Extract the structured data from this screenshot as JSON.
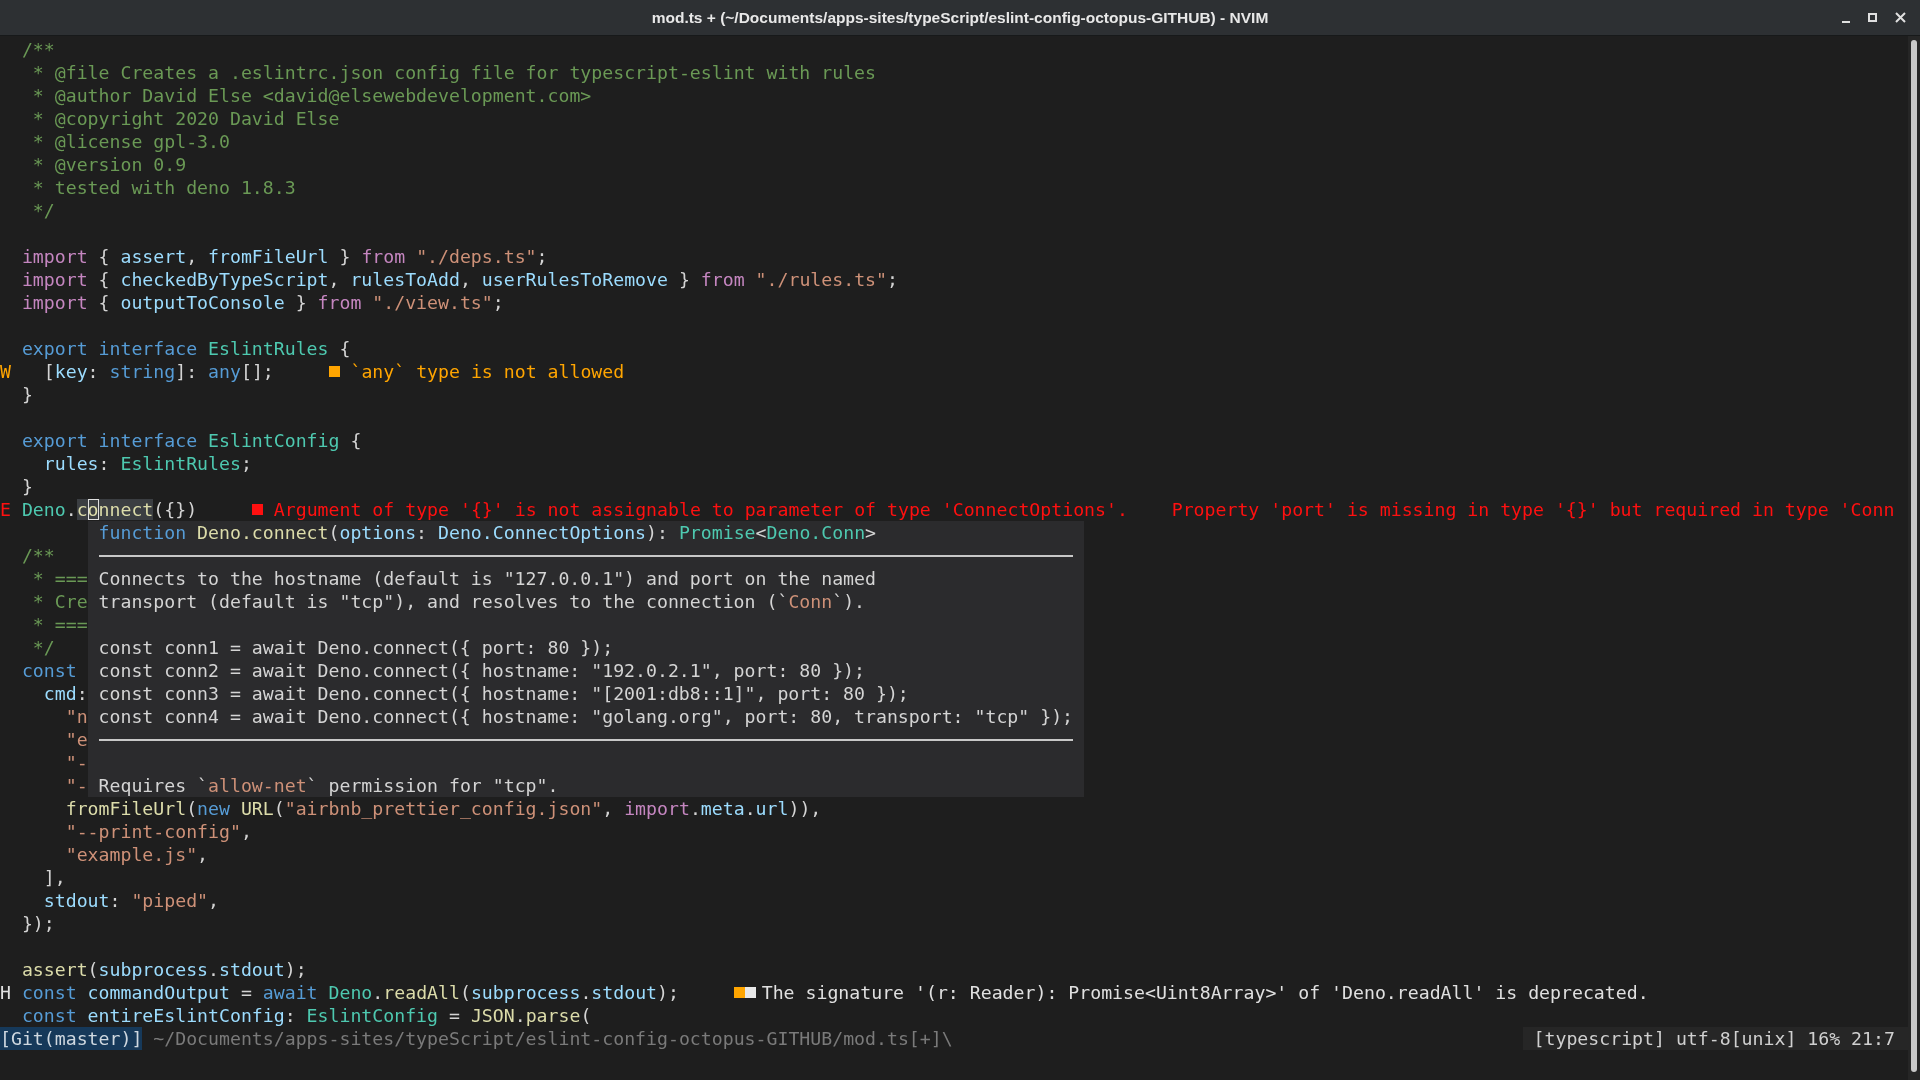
{
  "window": {
    "title": "mod.ts + (~/Documents/apps-sites/typeScript/eslint-config-octopus-GITHUB) - NVIM"
  },
  "lines": [
    {
      "kind": "code",
      "tokens": [
        {
          "kind": "comment",
          "text": "/**"
        }
      ]
    },
    {
      "kind": "code",
      "tokens": [
        {
          "kind": "comment",
          "text": " * @file Creates a .eslintrc.json config file for typescript-eslint with rules"
        }
      ]
    },
    {
      "kind": "code",
      "tokens": [
        {
          "kind": "comment",
          "text": " * @author David Else <david@elsewebdevelopment.com>"
        }
      ]
    },
    {
      "kind": "code",
      "tokens": [
        {
          "kind": "comment",
          "text": " * @copyright 2020 David Else"
        }
      ]
    },
    {
      "kind": "code",
      "tokens": [
        {
          "kind": "comment",
          "text": " * @license gpl-3.0"
        }
      ]
    },
    {
      "kind": "code",
      "tokens": [
        {
          "kind": "comment",
          "text": " * @version 0.9"
        }
      ]
    },
    {
      "kind": "code",
      "tokens": [
        {
          "kind": "comment",
          "text": " * tested with deno 1.8.3"
        }
      ]
    },
    {
      "kind": "code",
      "tokens": [
        {
          "kind": "comment",
          "text": " */"
        }
      ]
    },
    {
      "kind": "blank"
    },
    {
      "kind": "code",
      "tokens": [
        {
          "kind": "keyword",
          "text": "import"
        },
        {
          "kind": "plain",
          "text": " { "
        },
        {
          "kind": "variable",
          "text": "assert"
        },
        {
          "kind": "plain",
          "text": ", "
        },
        {
          "kind": "variable",
          "text": "fromFileUrl"
        },
        {
          "kind": "plain",
          "text": " } "
        },
        {
          "kind": "keyword",
          "text": "from "
        },
        {
          "kind": "string",
          "text": "\"./deps.ts\""
        },
        {
          "kind": "plain",
          "text": ";"
        }
      ]
    },
    {
      "kind": "code",
      "tokens": [
        {
          "kind": "keyword",
          "text": "import"
        },
        {
          "kind": "plain",
          "text": " { "
        },
        {
          "kind": "variable",
          "text": "checkedByTypeScript"
        },
        {
          "kind": "plain",
          "text": ", "
        },
        {
          "kind": "variable",
          "text": "rulesToAdd"
        },
        {
          "kind": "plain",
          "text": ", "
        },
        {
          "kind": "variable",
          "text": "userRulesToRemove"
        },
        {
          "kind": "plain",
          "text": " } "
        },
        {
          "kind": "keyword",
          "text": "from "
        },
        {
          "kind": "string",
          "text": "\"./rules.ts\""
        },
        {
          "kind": "plain",
          "text": ";"
        }
      ]
    },
    {
      "kind": "code",
      "tokens": [
        {
          "kind": "keyword",
          "text": "import"
        },
        {
          "kind": "plain",
          "text": " { "
        },
        {
          "kind": "variable",
          "text": "outputToConsole"
        },
        {
          "kind": "plain",
          "text": " } "
        },
        {
          "kind": "keyword",
          "text": "from "
        },
        {
          "kind": "string",
          "text": "\"./view.ts\""
        },
        {
          "kind": "plain",
          "text": ";"
        }
      ]
    },
    {
      "kind": "blank"
    },
    {
      "kind": "code",
      "tokens": [
        {
          "kind": "storage",
          "text": "export interface "
        },
        {
          "kind": "type",
          "text": "EslintRules"
        },
        {
          "kind": "plain",
          "text": " {"
        }
      ]
    },
    {
      "kind": "code",
      "sign": {
        "kind": "warning",
        "text": "W"
      },
      "tokens": [
        {
          "kind": "plain",
          "text": "  ["
        },
        {
          "kind": "variable",
          "text": "key"
        },
        {
          "kind": "plain",
          "text": ": "
        },
        {
          "kind": "storage",
          "text": "string"
        },
        {
          "kind": "plain",
          "text": "]: "
        },
        {
          "kind": "storage",
          "text": "any"
        },
        {
          "kind": "plain",
          "text": "[];"
        }
      ],
      "diagnostic": {
        "kind": "warning",
        "text": "`any` type is not allowed"
      }
    },
    {
      "kind": "code",
      "tokens": [
        {
          "kind": "plain",
          "text": "}"
        }
      ]
    },
    {
      "kind": "blank"
    },
    {
      "kind": "code",
      "tokens": [
        {
          "kind": "storage",
          "text": "export interface "
        },
        {
          "kind": "type",
          "text": "EslintConfig"
        },
        {
          "kind": "plain",
          "text": " {"
        }
      ]
    },
    {
      "kind": "code",
      "tokens": [
        {
          "kind": "variable",
          "text": "  rules"
        },
        {
          "kind": "plain",
          "text": ": "
        },
        {
          "kind": "type",
          "text": "EslintRules"
        },
        {
          "kind": "plain",
          "text": ";"
        }
      ]
    },
    {
      "kind": "code",
      "tokens": [
        {
          "kind": "plain",
          "text": "}"
        }
      ]
    },
    {
      "kind": "code",
      "sign": {
        "kind": "error",
        "text": "E"
      },
      "tokens": [
        {
          "kind": "type",
          "text": "Deno"
        },
        {
          "kind": "plain",
          "text": "."
        },
        {
          "kind": "function",
          "text": "c",
          "highlight": true
        },
        {
          "kind": "function",
          "text": "o",
          "highlight": true,
          "cursor": true
        },
        {
          "kind": "function",
          "text": "nnect",
          "highlight": true
        },
        {
          "kind": "plain",
          "text": "({})"
        }
      ],
      "diagnostic": {
        "kind": "error",
        "text": "Argument of type '{}' is not assignable to parameter of type 'ConnectOptions'.    Property 'port' is missing in type '{}' but required in type 'Conn"
      }
    },
    {
      "kind": "blank"
    },
    {
      "kind": "code",
      "tokens": [
        {
          "kind": "comment",
          "text": "/**"
        }
      ]
    },
    {
      "kind": "code",
      "tokens": [
        {
          "kind": "comment",
          "text": " * ==="
        }
      ]
    },
    {
      "kind": "code",
      "tokens": [
        {
          "kind": "comment",
          "text": " * Cre"
        }
      ]
    },
    {
      "kind": "code",
      "tokens": [
        {
          "kind": "comment",
          "text": " * ==="
        }
      ]
    },
    {
      "kind": "code",
      "tokens": [
        {
          "kind": "comment",
          "text": " */"
        }
      ]
    },
    {
      "kind": "code",
      "tokens": [
        {
          "kind": "storage",
          "text": "const"
        }
      ]
    },
    {
      "kind": "code",
      "tokens": [
        {
          "kind": "variable",
          "text": "  cmd"
        },
        {
          "kind": "plain",
          "text": ":"
        }
      ]
    },
    {
      "kind": "code",
      "tokens": [
        {
          "kind": "string",
          "text": "    \"n"
        }
      ]
    },
    {
      "kind": "code",
      "tokens": [
        {
          "kind": "string",
          "text": "    \"e"
        }
      ]
    },
    {
      "kind": "code",
      "tokens": [
        {
          "kind": "string",
          "text": "    \"-"
        }
      ]
    },
    {
      "kind": "code",
      "tokens": [
        {
          "kind": "string",
          "text": "    \"-"
        }
      ]
    },
    {
      "kind": "code",
      "tokens": [
        {
          "kind": "function",
          "text": "    fromFileUrl"
        },
        {
          "kind": "plain",
          "text": "("
        },
        {
          "kind": "storage",
          "text": "new "
        },
        {
          "kind": "function",
          "text": "URL"
        },
        {
          "kind": "plain",
          "text": "("
        },
        {
          "kind": "string",
          "text": "\"airbnb_prettier_config.json\""
        },
        {
          "kind": "plain",
          "text": ", "
        },
        {
          "kind": "keyword",
          "text": "import"
        },
        {
          "kind": "plain",
          "text": "."
        },
        {
          "kind": "variable",
          "text": "meta"
        },
        {
          "kind": "plain",
          "text": "."
        },
        {
          "kind": "variable",
          "text": "url"
        },
        {
          "kind": "plain",
          "text": ")),"
        }
      ]
    },
    {
      "kind": "code",
      "tokens": [
        {
          "kind": "string",
          "text": "    \"--print-config\""
        },
        {
          "kind": "plain",
          "text": ","
        }
      ]
    },
    {
      "kind": "code",
      "tokens": [
        {
          "kind": "string",
          "text": "    \"example.js\""
        },
        {
          "kind": "plain",
          "text": ","
        }
      ]
    },
    {
      "kind": "code",
      "tokens": [
        {
          "kind": "plain",
          "text": "  ],"
        }
      ]
    },
    {
      "kind": "code",
      "tokens": [
        {
          "kind": "variable",
          "text": "  stdout"
        },
        {
          "kind": "plain",
          "text": ": "
        },
        {
          "kind": "string",
          "text": "\"piped\""
        },
        {
          "kind": "plain",
          "text": ","
        }
      ]
    },
    {
      "kind": "code",
      "tokens": [
        {
          "kind": "plain",
          "text": "});"
        }
      ]
    },
    {
      "kind": "blank"
    },
    {
      "kind": "code",
      "tokens": [
        {
          "kind": "function",
          "text": "assert"
        },
        {
          "kind": "plain",
          "text": "("
        },
        {
          "kind": "variable",
          "text": "subprocess"
        },
        {
          "kind": "plain",
          "text": "."
        },
        {
          "kind": "variable",
          "text": "stdout"
        },
        {
          "kind": "plain",
          "text": ");"
        }
      ]
    },
    {
      "kind": "code",
      "sign": {
        "kind": "hint",
        "text": "H"
      },
      "tokens": [
        {
          "kind": "storage",
          "text": "const "
        },
        {
          "kind": "variable",
          "text": "commandOutput"
        },
        {
          "kind": "plain",
          "text": " = "
        },
        {
          "kind": "storage",
          "text": "await "
        },
        {
          "kind": "type",
          "text": "Deno"
        },
        {
          "kind": "plain",
          "text": "."
        },
        {
          "kind": "function",
          "text": "readAll"
        },
        {
          "kind": "plain",
          "text": "("
        },
        {
          "kind": "variable",
          "text": "subprocess"
        },
        {
          "kind": "plain",
          "text": "."
        },
        {
          "kind": "variable",
          "text": "stdout"
        },
        {
          "kind": "plain",
          "text": ");"
        }
      ],
      "diagnostic": {
        "kind": "hint",
        "text": "The signature '(r: Reader): Promise<Uint8Array>' of 'Deno.readAll' is deprecated."
      }
    },
    {
      "kind": "code",
      "tokens": [
        {
          "kind": "storage",
          "text": "const "
        },
        {
          "kind": "variable",
          "text": "entireEslintConfig"
        },
        {
          "kind": "plain",
          "text": ": "
        },
        {
          "kind": "type",
          "text": "EslintConfig"
        },
        {
          "kind": "plain",
          "text": " = "
        },
        {
          "kind": "function",
          "text": "JSON"
        },
        {
          "kind": "plain",
          "text": "."
        },
        {
          "kind": "function",
          "text": "parse"
        },
        {
          "kind": "plain",
          "text": "("
        }
      ]
    }
  ],
  "hover_popup": {
    "signature": [
      {
        "kind": "storage",
        "text": "function "
      },
      {
        "kind": "function",
        "text": "Deno.connect"
      },
      {
        "kind": "plain",
        "text": "("
      },
      {
        "kind": "variable",
        "text": "options"
      },
      {
        "kind": "plain",
        "text": ": "
      },
      {
        "kind": "variable",
        "text": "Deno.ConnectOptions"
      },
      {
        "kind": "plain",
        "text": "): "
      },
      {
        "kind": "type",
        "text": "Promise"
      },
      {
        "kind": "plain",
        "text": "<"
      },
      {
        "kind": "type",
        "text": "Deno.Conn"
      },
      {
        "kind": "plain",
        "text": ">"
      }
    ],
    "description": [
      [
        {
          "kind": "plain",
          "text": "Connects to the hostname (default is \"127.0.0.1\") and port on the named"
        }
      ],
      [
        {
          "kind": "plain",
          "text": "transport (default is \"tcp\"), and resolves to the connection (`"
        },
        {
          "kind": "string",
          "text": "Conn"
        },
        {
          "kind": "plain",
          "text": "`)."
        }
      ]
    ],
    "examples": [
      "const conn1 = await Deno.connect({ port: 80 });",
      "const conn2 = await Deno.connect({ hostname: \"192.0.2.1\", port: 80 });",
      "const conn3 = await Deno.connect({ hostname: \"[2001:db8::1]\", port: 80 });",
      "const conn4 = await Deno.connect({ hostname: \"golang.org\", port: 80, transport: \"tcp\" });"
    ],
    "note": [
      {
        "kind": "plain",
        "text": "Requires `"
      },
      {
        "kind": "string",
        "text": "allow-net"
      },
      {
        "kind": "plain",
        "text": "` permission for \"tcp\"."
      }
    ]
  },
  "status_bar": {
    "branch": "[Git(master)]",
    "path": "~/Documents/apps-sites/typeScript/eslint-config-octopus-GITHUB/mod.ts[+]\\",
    "file_info": "[typescript] utf-8[unix] 16% 21:7"
  }
}
